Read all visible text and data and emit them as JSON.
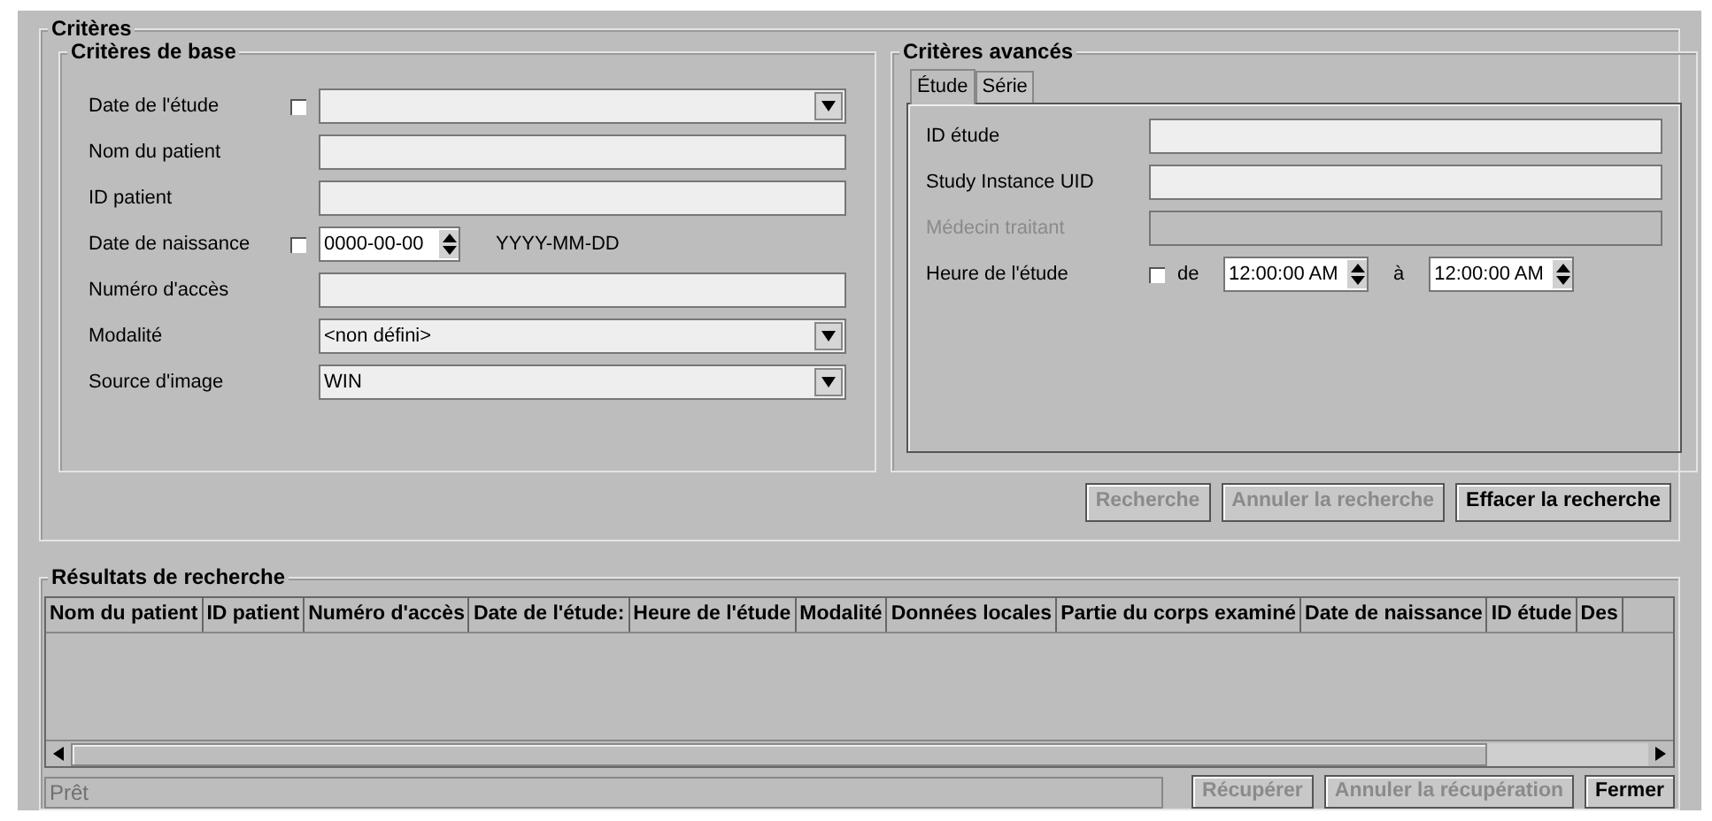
{
  "criteria": {
    "title": "Critères",
    "basic": {
      "title": "Critères de base",
      "fields": [
        {
          "kind": "combo",
          "label": "Date de l'étude",
          "checked": false
        },
        {
          "kind": "text",
          "label": "Nom du patient"
        },
        {
          "kind": "text",
          "label": "ID patient"
        },
        {
          "kind": "date",
          "label": "Date de naissance",
          "checked": false,
          "value": "0000-00-00",
          "hint": "YYYY-MM-DD"
        },
        {
          "kind": "text",
          "label": "Numéro d'accès"
        },
        {
          "kind": "combo",
          "label": "Modalité",
          "value": "<non défini>"
        },
        {
          "kind": "combo",
          "label": "Source d'image",
          "value": "WIN"
        }
      ]
    },
    "advanced": {
      "title": "Critères avancés",
      "tabs": [
        {
          "label": "Étude",
          "selected": true
        },
        {
          "label": "Série",
          "selected": false
        }
      ],
      "fields": [
        {
          "kind": "text",
          "label": "ID étude",
          "disabled": false
        },
        {
          "kind": "text",
          "label": "Study Instance UID",
          "disabled": false
        },
        {
          "kind": "text",
          "label": "Médecin traitant",
          "disabled": true
        },
        {
          "kind": "time",
          "label": "Heure de l'étude",
          "checked": false,
          "from_label": "de",
          "from": "12:00:00 AM",
          "to_label": "à",
          "to": "12:00:00 AM"
        }
      ]
    },
    "buttons": [
      {
        "label": "Recherche",
        "disabled": true
      },
      {
        "label": "Annuler la recherche",
        "disabled": true
      },
      {
        "label": "Effacer la recherche",
        "disabled": false
      }
    ]
  },
  "results": {
    "title": "Résultats de recherche",
    "columns": [
      "Nom du patient",
      "ID patient",
      "Numéro d'accès",
      "Date de l'étude:",
      "Heure de l'étude",
      "Modalité",
      "Données locales",
      "Partie du corps examiné",
      "Date de naissance",
      "ID étude",
      "Des"
    ],
    "status": "Prêt",
    "buttons": [
      {
        "label": "Récupérer",
        "disabled": true
      },
      {
        "label": "Annuler la récupération",
        "disabled": true
      },
      {
        "label": "Fermer",
        "disabled": false
      }
    ]
  }
}
